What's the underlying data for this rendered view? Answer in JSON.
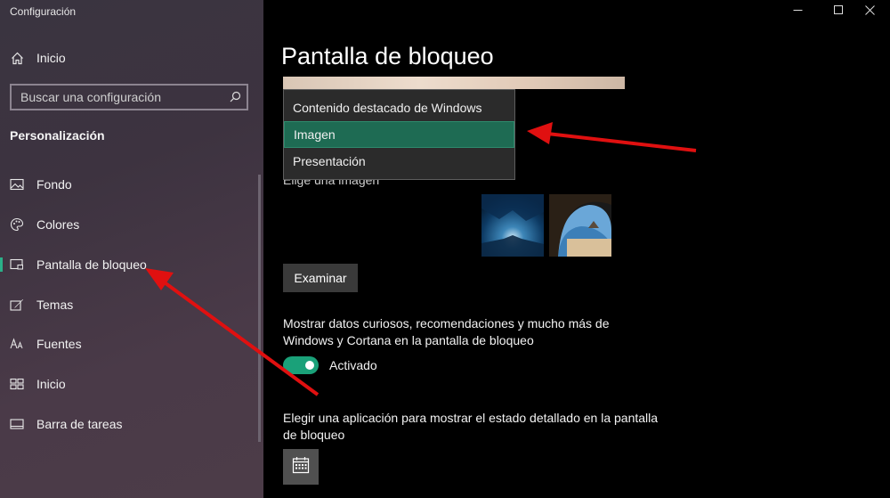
{
  "window": {
    "title": "Configuración",
    "minimize_icon": "minimize-icon",
    "maximize_icon": "maximize-icon",
    "close_icon": "close-icon"
  },
  "sidebar": {
    "home_label": "Inicio",
    "search_placeholder": "Buscar una configuración",
    "section_title": "Personalización",
    "items": [
      {
        "label": "Fondo",
        "icon": "image-icon"
      },
      {
        "label": "Colores",
        "icon": "palette-icon"
      },
      {
        "label": "Pantalla de bloqueo",
        "icon": "lock-screen-icon",
        "selected": true
      },
      {
        "label": "Temas",
        "icon": "brush-icon"
      },
      {
        "label": "Fuentes",
        "icon": "font-icon"
      },
      {
        "label": "Inicio",
        "icon": "start-icon"
      },
      {
        "label": "Barra de tareas",
        "icon": "taskbar-icon"
      }
    ]
  },
  "main": {
    "title": "Pantalla de bloqueo",
    "background_options": [
      "Contenido destacado de Windows",
      "Imagen",
      "Presentación"
    ],
    "selected_option": "Imagen",
    "choose_image_label": "Elige una imagen",
    "browse_button": "Examinar",
    "fun_facts_text": "Mostrar datos curiosos, recomendaciones y mucho más de Windows y Cortana en la pantalla de bloqueo",
    "toggle_state": "Activado",
    "detailed_status_text": "Elegir una aplicación para mostrar el estado detallado en la pantalla de bloqueo",
    "app_icon": "calendar-icon"
  },
  "colors": {
    "accent": "#1aa179",
    "arrow": "#e01010",
    "selection": "#1e6b53"
  }
}
